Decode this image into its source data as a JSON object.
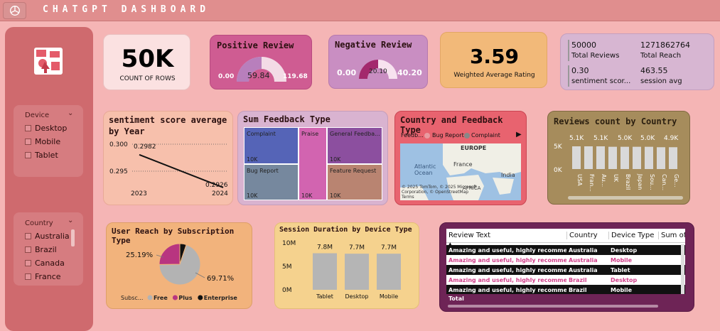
{
  "header": {
    "title": "CHATGPT DASHBOARD"
  },
  "slicers": {
    "device": {
      "label": "Device",
      "items": [
        "Desktop",
        "Mobile",
        "Tablet"
      ]
    },
    "country": {
      "label": "Country",
      "items": [
        "Australia",
        "Brazil",
        "Canada",
        "France"
      ]
    }
  },
  "kpis": {
    "rows": {
      "value": "50K",
      "label": "COUNT OF ROWS"
    },
    "positive": {
      "title": "Positive Review",
      "min": "0.00",
      "value": "59.84",
      "max": "119.68",
      "fraction": 0.5
    },
    "negative": {
      "title": "Negative Review",
      "min": "0.00",
      "value": "20.10",
      "max": "40.20",
      "fraction": 0.5
    },
    "rating": {
      "value": "3.59",
      "label": "Weighted Average Rating"
    },
    "multi": [
      {
        "value": "50000",
        "label": "Total Reviews"
      },
      {
        "value": "1271862764",
        "label": "Total Reach"
      },
      {
        "value": "0.30",
        "label": "sentiment scor..."
      },
      {
        "value": "463.55",
        "label": "session avg"
      }
    ]
  },
  "sentiment": {
    "title": "sentiment score average by Year",
    "yticks": [
      "0.300",
      "0.295"
    ],
    "xticks": [
      "2023",
      "2024"
    ],
    "labels": [
      "0.2982",
      "0.2926"
    ]
  },
  "treemap": {
    "title": "Sum Feedback Type",
    "cells": [
      {
        "name": "Complaint",
        "value": "10K"
      },
      {
        "name": "Praise",
        "value": "10K"
      },
      {
        "name": "General Feedba...",
        "value": "10K"
      },
      {
        "name": "Bug Report",
        "value": "10K"
      },
      {
        "name": "Feature Request",
        "value": "10K"
      }
    ]
  },
  "map": {
    "title": "Country and Feedback Type",
    "legend_label": "Feedb...",
    "legend": [
      "Bug Report",
      "Complaint"
    ],
    "places": [
      "EUROPE",
      "Atlantic Ocean",
      "France",
      "India",
      "AFRICA"
    ],
    "attribution": "© 2025 TomTom, © 2025 Microsoft Corporation, © OpenStreetMap Terms"
  },
  "chart_data": [
    {
      "type": "line",
      "title": "sentiment score average by Year",
      "x": [
        "2023",
        "2024"
      ],
      "values": [
        0.2982,
        0.2926
      ],
      "ylim": [
        0.2926,
        0.3
      ]
    },
    {
      "type": "bar",
      "title": "Reviews count by Country",
      "categories": [
        "USA",
        "Fran...",
        "Au...",
        "UK",
        "Brazil",
        "Japan",
        "Sou...",
        "Can...",
        "Ge..."
      ],
      "values": [
        5.1,
        5.1,
        5.1,
        5.0,
        5.0,
        5.0,
        5.0,
        4.9,
        4.9
      ],
      "data_labels": [
        "5.1K",
        "5.1K",
        "5.0K",
        "5.0K",
        "4.9K"
      ],
      "yticks": [
        "5K",
        "0K"
      ]
    },
    {
      "type": "pie",
      "title": "User Reach by Subscription Type",
      "legend_title": "Subsc...",
      "series": [
        {
          "name": "Free",
          "value": 69.71,
          "color": "#b3b3b3"
        },
        {
          "name": "Plus",
          "value": 25.19,
          "color": "#b83580"
        },
        {
          "name": "Enterprise",
          "value": 5.1,
          "color": "#111111"
        }
      ],
      "data_labels": [
        "25.19%",
        "69.71%"
      ]
    },
    {
      "type": "bar",
      "title": "Session Duration by Device Type",
      "categories": [
        "Tablet",
        "Desktop",
        "Mobile"
      ],
      "values": [
        7.8,
        7.7,
        7.7
      ],
      "data_labels": [
        "7.8M",
        "7.7M",
        "7.7M"
      ],
      "yticks": [
        "10M",
        "5M",
        "0M"
      ],
      "ylim": [
        0,
        10
      ]
    }
  ],
  "table": {
    "headers": [
      "Review Text",
      "Country",
      "Device Type",
      "Sum of"
    ],
    "rows": [
      [
        "Amazing and useful, highly recommend.",
        "Australia",
        "Desktop"
      ],
      [
        "Amazing and useful, highly recommend.",
        "Australia",
        "Mobile"
      ],
      [
        "Amazing and useful, highly recommend.",
        "Australia",
        "Tablet"
      ],
      [
        "Amazing and useful, highly recommend.",
        "Brazil",
        "Desktop"
      ],
      [
        "Amazing and useful, highly recommend.",
        "Brazil",
        "Mobile"
      ]
    ],
    "total": "Total"
  },
  "bar_colors": {
    "country": "#d9d9d9",
    "session": "#b5b5b5"
  }
}
